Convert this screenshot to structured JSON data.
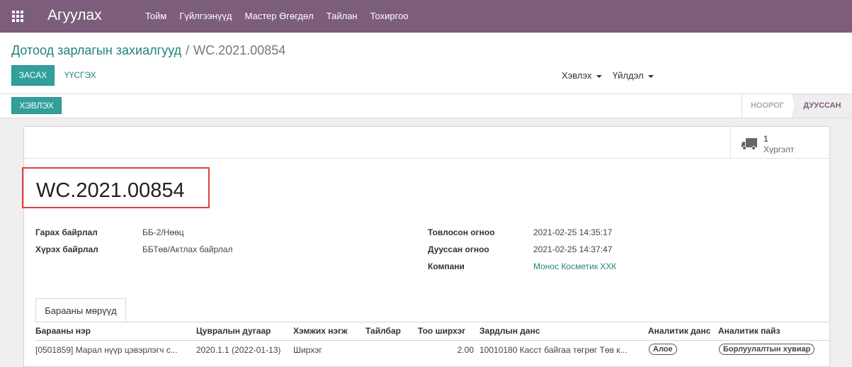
{
  "navbar": {
    "app_title": "Агуулах",
    "menu": [
      "Тойм",
      "Гүйлгээнүүд",
      "Мастер Өгөгдөл",
      "Тайлан",
      "Тохиргоо"
    ]
  },
  "breadcrumb": {
    "parent": "Дотоод зарлагын захиалгууд",
    "separator": "/",
    "current": "WC.2021.00854"
  },
  "toolbar": {
    "edit": "ЗАСАХ",
    "create": "ҮҮСГЭХ",
    "print_dropdown": "Хэвлэх",
    "action_dropdown": "Үйлдэл"
  },
  "statusbar": {
    "print_button": "ХЭВЛЭХ",
    "stages": [
      "НООРОГ",
      "ДУУССАН"
    ],
    "active_stage": "ДУУССАН"
  },
  "smart_button": {
    "value": "1",
    "label": "Хүргэлт"
  },
  "record": {
    "name": "WC.2021.00854",
    "source_location_label": "Гарах байрлал",
    "source_location": "ББ-2/Нөөц",
    "dest_location_label": "Хүрэх байрлал",
    "dest_location": "ББТөв/Актлах байрлал",
    "scheduled_label": "Товлосон огноо",
    "scheduled": "2021-02-25 14:35:17",
    "done_label": "Дууссан огноо",
    "done": "2021-02-25 14:37:47",
    "company_label": "Компани",
    "company": "Монос Косметик ХХК"
  },
  "notebook": {
    "tab": "Барааны мөрүүд",
    "columns": [
      "Барааны нэр",
      "Цувралын дугаар",
      "Хэмжих нэгж",
      "Тайлбар",
      "Тоо ширхэг",
      "Зардлын данс",
      "Аналитик данс",
      "Аналитик пайз"
    ],
    "rows": [
      {
        "product": "[0501859] Марал нүүр цэвэрлэгч с...",
        "lot": "2020.1.1 (2022-01-13)",
        "uom": "Ширхэг",
        "note": "",
        "qty": "2.00",
        "account": "10010180 Касст байгаа төгрөг Төв к...",
        "analytic_account": "Алое",
        "analytic_tag": "Борлуулалтын хувиар"
      }
    ]
  }
}
